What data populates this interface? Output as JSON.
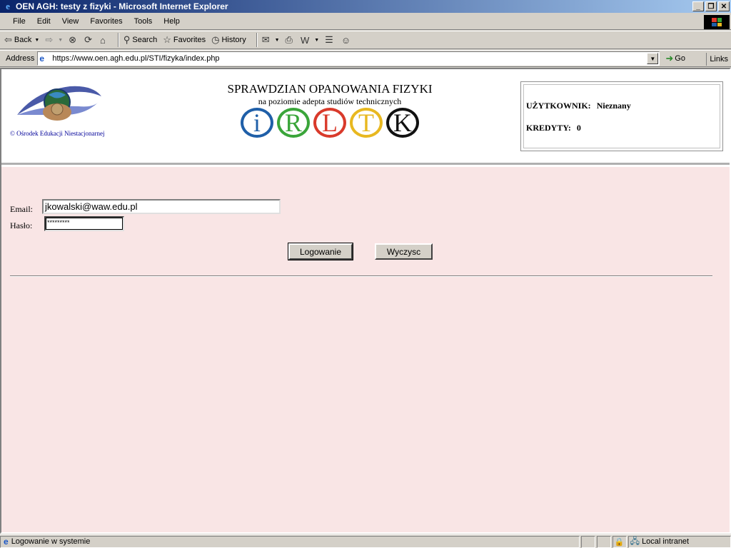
{
  "window": {
    "title": "OEN AGH: testy z fizyki - Microsoft Internet Explorer",
    "minimize": "_",
    "restore": "❐",
    "close": "✕"
  },
  "menu": [
    "File",
    "Edit",
    "View",
    "Favorites",
    "Tools",
    "Help"
  ],
  "toolbar": {
    "back": "Back",
    "search": "Search",
    "favorites": "Favorites",
    "history": "History"
  },
  "address": {
    "label": "Address",
    "url": "https://www.oen.agh.edu.pl/STI/fizyka/index.php",
    "go": "Go",
    "links": "Links"
  },
  "header": {
    "logo_caption": "© Ośrodek Edukacji Niestacjonarnej",
    "title": "SPRAWDZIAN OPANOWANIA FIZYKI",
    "subtitle": "na poziomie adepta studiów technicznych",
    "circles": [
      {
        "letter": "i",
        "color": "#1f5fa8"
      },
      {
        "letter": "R",
        "color": "#3aa53a"
      },
      {
        "letter": "L",
        "color": "#d93a2b"
      },
      {
        "letter": "T",
        "color": "#e8b820"
      },
      {
        "letter": "K",
        "color": "#111111"
      }
    ]
  },
  "user": {
    "user_label": "UŻYTKOWNIK:",
    "user_value": "Nieznany",
    "credits_label": "KREDYTY:",
    "credits_value": "0"
  },
  "form": {
    "email_label": "Email:",
    "email_value": "jkowalski@waw.edu.pl",
    "password_label": "Hasło:",
    "password_value": "*********",
    "login_button": "Logowanie",
    "clear_button": "Wyczysc"
  },
  "status": {
    "text": "Logowanie w systemie",
    "zone": "Local intranet"
  }
}
